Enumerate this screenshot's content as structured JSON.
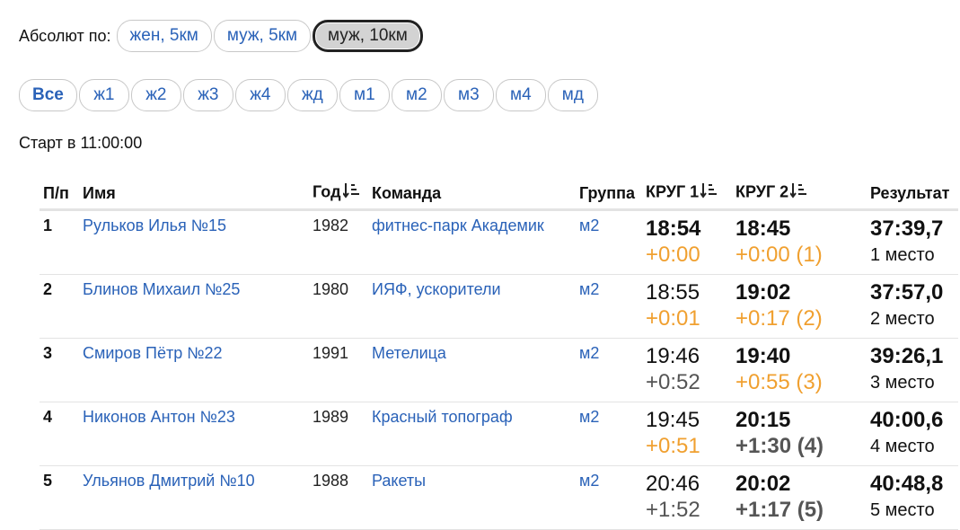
{
  "absolute": {
    "label": "Абсолют по:",
    "options": [
      "жен, 5км",
      "муж, 5км",
      "муж, 10км"
    ],
    "active_index": 2
  },
  "groups": {
    "options": [
      "Все",
      "ж1",
      "ж2",
      "ж3",
      "ж4",
      "жд",
      "м1",
      "м2",
      "м3",
      "м4",
      "мд"
    ],
    "active_index": 0
  },
  "start": "Старт в 11:00:00",
  "table": {
    "headers": {
      "num": "П/п",
      "name": "Имя",
      "year": "Год",
      "team": "Команда",
      "group": "Группа",
      "lap1": "КРУГ 1",
      "lap2": "КРУГ 2",
      "result": "Результат"
    },
    "rows": [
      {
        "num": "1",
        "name": "Рульков Илья №15",
        "year": "1982",
        "team": "фитнес-парк Академик",
        "group": "м2",
        "lap1": "18:54",
        "lap1_delta": "+0:00",
        "lap2": "18:45",
        "lap2_delta": "+0:00 (1)",
        "result": "37:39,7",
        "place": "1 место"
      },
      {
        "num": "2",
        "name": "Блинов Михаил №25",
        "year": "1980",
        "team": "ИЯФ, ускорители",
        "group": "м2",
        "lap1": "18:55",
        "lap1_delta": "+0:01",
        "lap2": "19:02",
        "lap2_delta": "+0:17 (2)",
        "result": "37:57,0",
        "place": "2 место"
      },
      {
        "num": "3",
        "name": "Смиров Пётр №22",
        "year": "1991",
        "team": "Метелица",
        "group": "м2",
        "lap1": "19:46",
        "lap1_delta": "+0:52",
        "lap2": "19:40",
        "lap2_delta": "+0:55 (3)",
        "result": "39:26,1",
        "place": "3 место"
      },
      {
        "num": "4",
        "name": "Никонов Антон №23",
        "year": "1989",
        "team": "Красный топограф",
        "group": "м2",
        "lap1": "19:45",
        "lap1_delta": "+0:51",
        "lap2": "20:15",
        "lap2_delta": "+1:30 (4)",
        "result": "40:00,6",
        "place": "4 место"
      },
      {
        "num": "5",
        "name": "Ульянов Дмитрий №10",
        "year": "1988",
        "team": "Ракеты",
        "group": "м2",
        "lap1": "20:46",
        "lap1_delta": "+1:52",
        "lap2": "20:02",
        "lap2_delta": "+1:17 (5)",
        "result": "40:48,8",
        "place": "5 место"
      }
    ]
  },
  "colors": {
    "link": "#2a62b8",
    "lead": "#f0a030",
    "muted": "#555555"
  }
}
